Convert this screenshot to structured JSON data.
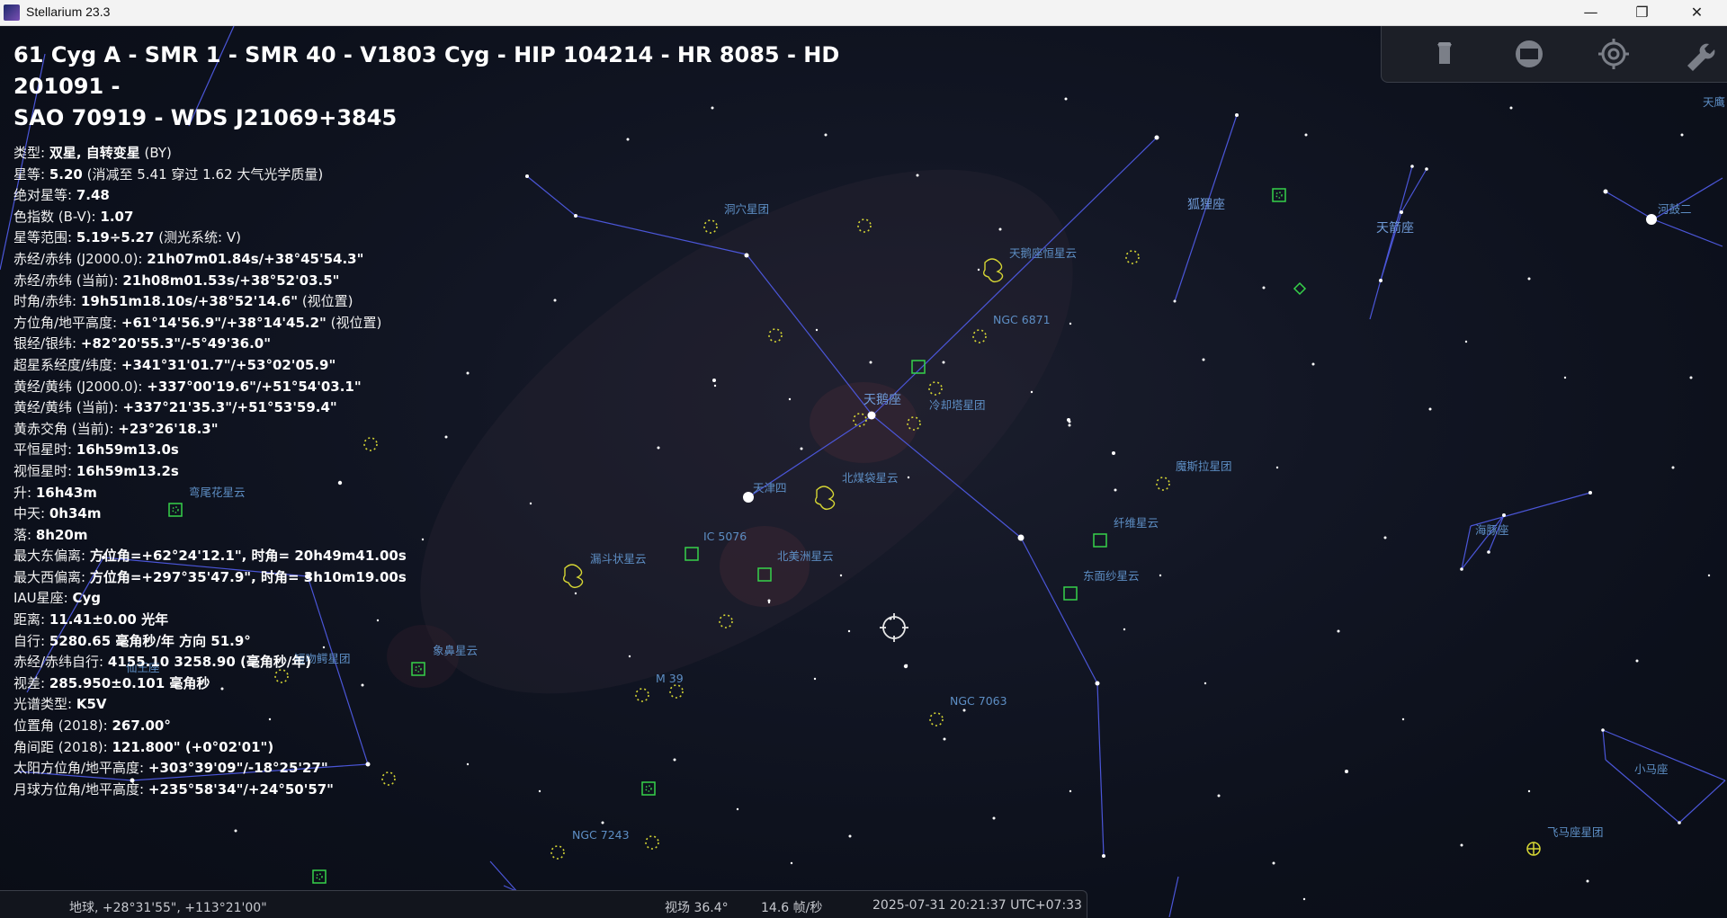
{
  "window": {
    "title": "Stellarium 23.3",
    "minimize_glyph": "—",
    "restore_glyph": "❐",
    "close_glyph": "✕"
  },
  "info": {
    "headline_line1": "61 Cyg A - SMR 1 - SMR 40 - V1803 Cyg - HIP 104214 - HR 8085 - HD 201091 -",
    "headline_line2": "SAO 70919 - WDS J21069+3845",
    "lines": [
      {
        "label": "类型: ",
        "value": "双星, 自转变星",
        "extra": " (BY)"
      },
      {
        "label": "星等: ",
        "value": "5.20",
        "extra": " (消减至 5.41 穿过 1.62 大气光学质量)"
      },
      {
        "label": "绝对星等: ",
        "value": "7.48",
        "extra": ""
      },
      {
        "label": "色指数 (B-V): ",
        "value": "1.07",
        "extra": ""
      },
      {
        "label": "星等范围: ",
        "value": "5.19÷5.27",
        "extra": " (测光系统: V)"
      },
      {
        "label": "赤经/赤纬 (J2000.0): ",
        "value": "21h07m01.84s/+38°45'54.3\"",
        "extra": ""
      },
      {
        "label": "赤经/赤纬 (当前): ",
        "value": "21h08m01.53s/+38°52'03.5\"",
        "extra": ""
      },
      {
        "label": "时角/赤纬: ",
        "value": "19h51m18.10s/+38°52'14.6\"",
        "extra": " (视位置)"
      },
      {
        "label": "方位角/地平高度: ",
        "value": "+61°14'56.9\"/+38°14'45.2\"",
        "extra": " (视位置)"
      },
      {
        "label": "银经/银纬: ",
        "value": "+82°20'55.3\"/-5°49'36.0\"",
        "extra": ""
      },
      {
        "label": "超星系经度/纬度: ",
        "value": "+341°31'01.7\"/+53°02'05.9\"",
        "extra": ""
      },
      {
        "label": "黄经/黄纬 (J2000.0): ",
        "value": "+337°00'19.6\"/+51°54'03.1\"",
        "extra": ""
      },
      {
        "label": "黄经/黄纬 (当前): ",
        "value": "+337°21'35.3\"/+51°53'59.4\"",
        "extra": ""
      },
      {
        "label": "黄赤交角 (当前): ",
        "value": "+23°26'18.3\"",
        "extra": ""
      },
      {
        "label": "平恒星时: ",
        "value": "16h59m13.0s",
        "extra": ""
      },
      {
        "label": "视恒星时: ",
        "value": "16h59m13.2s",
        "extra": ""
      },
      {
        "label": "升: ",
        "value": "16h43m",
        "extra": ""
      },
      {
        "label": "中天: ",
        "value": "0h34m",
        "extra": ""
      },
      {
        "label": "落: ",
        "value": "8h20m",
        "extra": ""
      },
      {
        "label": "最大东偏离: ",
        "value": "方位角=+62°24'12.1\", 时角= 20h49m41.00s",
        "extra": ""
      },
      {
        "label": "最大西偏离: ",
        "value": "方位角=+297°35'47.9\", 时角= 3h10m19.00s",
        "extra": ""
      },
      {
        "label": "IAU星座: ",
        "value": "Cyg",
        "extra": ""
      },
      {
        "label": "距离: ",
        "value": "11.41±0.00 光年",
        "extra": ""
      },
      {
        "label": "自行: ",
        "value": "5280.65 毫角秒/年 方向 51.9°",
        "extra": ""
      },
      {
        "label": "赤经/赤纬自行: ",
        "value": "4155.10 3258.90 (毫角秒/年)",
        "extra": ""
      },
      {
        "label": "视差: ",
        "value": "285.950±0.101 毫角秒",
        "extra": ""
      },
      {
        "label": "光谱类型: ",
        "value": "K5V",
        "extra": ""
      },
      {
        "label": "位置角 (2018): ",
        "value": "267.00°",
        "extra": ""
      },
      {
        "label": "角间距 (2018): ",
        "value": "121.800\" (+0°02'01\")",
        "extra": ""
      },
      {
        "label": "太阳方位角/地平高度: ",
        "value": "+303°39'09\"/-18°25'27\"",
        "extra": ""
      },
      {
        "label": "月球方位角/地平高度: ",
        "value": "+235°58'34\"/+24°50'57\"",
        "extra": ""
      }
    ]
  },
  "sky_labels": {
    "cygnus": "天鹅座",
    "deneb": "天津四",
    "vulpecula": "狐狸座",
    "sagitta": "天箭座",
    "altair": "河鼓二",
    "aquila_partial": "天鹰",
    "delphinus": "海豚座",
    "equuleus": "小马座",
    "lacerta_partial": "仙王座",
    "cave_nebula": "洞穴星团",
    "crescent_nebula": "天鹅座恒星云",
    "ngc6871": "NGC 6871",
    "cooling_tower": "冷却塔星团",
    "north_coalsack": "北煤袋星云",
    "mu_cluster": "魔斯拉星团",
    "veil_west": "纤维星云",
    "veil_east": "东面纱星云",
    "ic5076": "IC 5076",
    "north_america": "北美洲星云",
    "pelican": "漏斗状星云",
    "elephant_trunk": "象鼻星云",
    "cocoon": "弯尾花星云",
    "short_cluster": "短吻鳄星团",
    "m39": "M 39",
    "ngc7063": "NGC 7063",
    "ngc7243": "NGC 7243",
    "pegasus_cluster": "飞马座星团"
  },
  "status": {
    "location": "地球, +28°31'55\", +113°21'00\"",
    "fov": "视场 36.4°",
    "fps": "14.6 帧/秒",
    "datetime": "2025-07-31 20:21:37 UTC+07:33"
  },
  "toolbar": {
    "buttons": [
      "ocular-icon",
      "screen-icon",
      "target-icon",
      "wrench-icon"
    ]
  },
  "colors": {
    "constellation_line": "#4b56d8",
    "dso_marker": "#d6d634",
    "nebula_marker": "#36d24a",
    "label": "#6f9bd8"
  }
}
